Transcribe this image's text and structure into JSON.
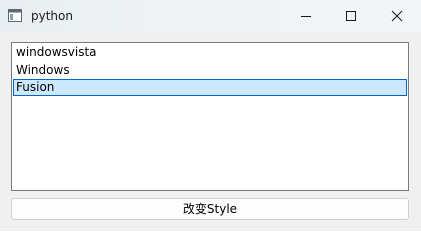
{
  "window": {
    "title": "python",
    "icons": {
      "app": "app-window-icon",
      "minimize": "minimize-icon",
      "maximize": "maximize-icon",
      "close": "close-icon"
    }
  },
  "list": {
    "items": [
      {
        "label": "windowsvista",
        "selected": false
      },
      {
        "label": "Windows",
        "selected": false
      },
      {
        "label": "Fusion",
        "selected": true
      }
    ],
    "selection_color": "#cce8ff",
    "selection_border": "#0067c0"
  },
  "button": {
    "label": "改变Style"
  }
}
